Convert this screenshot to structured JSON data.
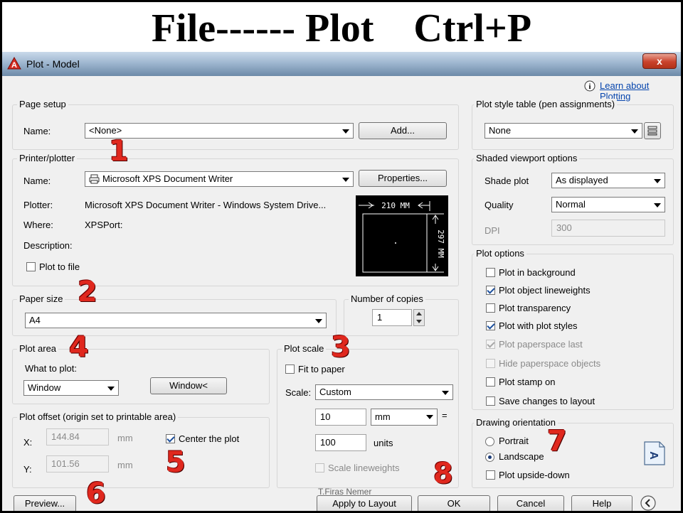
{
  "headline": "File------ Plot    Ctrl+P",
  "window": {
    "title": "Plot - Model",
    "close_glyph": "x"
  },
  "help_link": {
    "icon": "i",
    "text": "Learn about Plotting"
  },
  "page_setup": {
    "group": "Page setup",
    "name_label": "Name:",
    "name_value": "<None>",
    "add_button": "Add..."
  },
  "printer": {
    "group": "Printer/plotter",
    "name_label": "Name:",
    "name_value": "Microsoft XPS Document Writer",
    "properties_button": "Properties...",
    "plotter_label": "Plotter:",
    "plotter_value": "Microsoft XPS Document Writer - Windows System Drive...",
    "where_label": "Where:",
    "where_value": "XPSPort:",
    "description_label": "Description:",
    "plot_to_file": "Plot to file",
    "plot_to_file_checked": false,
    "paper_width": "210 MM",
    "paper_height": "297 MM"
  },
  "paper_size": {
    "group": "Paper size",
    "value": "A4"
  },
  "copies": {
    "group": "Number of copies",
    "value": "1"
  },
  "plot_area": {
    "group": "Plot area",
    "what_label": "What to plot:",
    "what_value": "Window",
    "window_button": "Window<"
  },
  "plot_scale": {
    "group": "Plot scale",
    "fit_to_paper": "Fit to paper",
    "fit_checked": false,
    "scale_label": "Scale:",
    "scale_value": "Custom",
    "value1": "10",
    "unit1": "mm",
    "equals": "=",
    "value2": "100",
    "unit2": "units",
    "scale_lineweights": "Scale lineweights"
  },
  "plot_offset": {
    "group": "Plot offset (origin set to printable area)",
    "x_label": "X:",
    "x_value": "144.84",
    "x_unit": "mm",
    "y_label": "Y:",
    "y_value": "101.56",
    "y_unit": "mm",
    "center": "Center the plot",
    "center_checked": true
  },
  "plot_style_table": {
    "group": "Plot style table (pen assignments)",
    "value": "None"
  },
  "shaded": {
    "group": "Shaded viewport options",
    "shade_label": "Shade plot",
    "shade_value": "As displayed",
    "quality_label": "Quality",
    "quality_value": "Normal",
    "dpi_label": "DPI",
    "dpi_value": "300"
  },
  "plot_options": {
    "group": "Plot options",
    "items": [
      {
        "label": "Plot in background",
        "checked": false,
        "disabled": false
      },
      {
        "label": "Plot object lineweights",
        "checked": true,
        "disabled": false
      },
      {
        "label": "Plot transparency",
        "checked": false,
        "disabled": false
      },
      {
        "label": "Plot with plot styles",
        "checked": true,
        "disabled": false
      },
      {
        "label": "Plot paperspace last",
        "checked": true,
        "disabled": true
      },
      {
        "label": "Hide paperspace objects",
        "checked": false,
        "disabled": true
      },
      {
        "label": "Plot stamp on",
        "checked": false,
        "disabled": false
      },
      {
        "label": "Save changes to layout",
        "checked": false,
        "disabled": false
      }
    ]
  },
  "orientation": {
    "group": "Drawing orientation",
    "portrait": "Portrait",
    "landscape": "Landscape",
    "selected": "landscape",
    "upside_down": "Plot upside-down",
    "upside_checked": false
  },
  "buttons": {
    "preview": "Preview...",
    "apply": "Apply to Layout",
    "ok": "OK",
    "cancel": "Cancel",
    "help": "Help"
  },
  "watermark": "T.Firas Nemer",
  "annotations": [
    "1",
    "2",
    "3",
    "4",
    "5",
    "6",
    "7",
    "8"
  ],
  "colors": {
    "annotation": "#e0281e",
    "link": "#0645ad",
    "dialog_bg": "#f0f0f0"
  }
}
